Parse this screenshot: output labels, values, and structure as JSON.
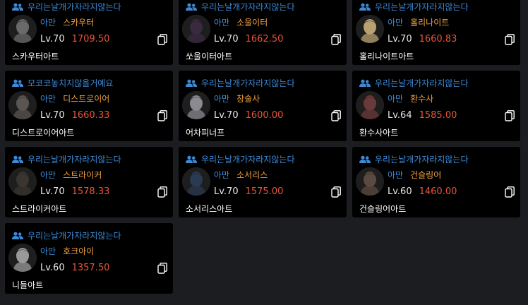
{
  "cards": [
    {
      "guild": "우리는날개가자라지않는다",
      "server": "아만",
      "class": "스카우터",
      "level": "Lv.70",
      "item_level": "1709.50",
      "name": "스카우터아트",
      "avatar_color": "#6a6a6a"
    },
    {
      "guild": "우리는날개가자라지않는다",
      "server": "아만",
      "class": "소울이터",
      "level": "Lv.70",
      "item_level": "1662.50",
      "name": "쏘울이터아트",
      "avatar_color": "#3a2a40"
    },
    {
      "guild": "우리는날개가자라지않는다",
      "server": "아만",
      "class": "홀리나이트",
      "level": "Lv.70",
      "item_level": "1660.83",
      "name": "홀리나이트아트",
      "avatar_color": "#b8a070"
    },
    {
      "guild": "모코코놓치지않을거예요",
      "server": "아만",
      "class": "디스트로이어",
      "level": "Lv.70",
      "item_level": "1660.33",
      "name": "디스트로이어아트",
      "avatar_color": "#5a5550"
    },
    {
      "guild": "우리는날개가자라지않는다",
      "server": "아만",
      "class": "창술사",
      "level": "Lv.70",
      "item_level": "1600.00",
      "name": "어차피너프",
      "avatar_color": "#8a8a90"
    },
    {
      "guild": "우리는날개가자라지않는다",
      "server": "아만",
      "class": "환수사",
      "level": "Lv.64",
      "item_level": "1585.00",
      "name": "환수사아트",
      "avatar_color": "#6a3a3a"
    },
    {
      "guild": "우리는날개가자라지않는다",
      "server": "아만",
      "class": "스트라이커",
      "level": "Lv.70",
      "item_level": "1578.33",
      "name": "스트라이커아트",
      "avatar_color": "#3a3530"
    },
    {
      "guild": "우리는날개가자라지않는다",
      "server": "아만",
      "class": "소서리스",
      "level": "Lv.70",
      "item_level": "1575.00",
      "name": "소서리스아트",
      "avatar_color": "#2a3a50"
    },
    {
      "guild": "우리는날개가자라지않는다",
      "server": "아만",
      "class": "건슬링어",
      "level": "Lv.60",
      "item_level": "1460.00",
      "name": "건슬링어아트",
      "avatar_color": "#5a4a40"
    },
    {
      "guild": "우리는날개가자라지않는다",
      "server": "아만",
      "class": "호크아이",
      "level": "Lv.60",
      "item_level": "1357.50",
      "name": "니들아트",
      "avatar_color": "#9a9a9a"
    }
  ],
  "colors": {
    "guild": "#3d8bd8",
    "class": "#f0a040",
    "item_level": "#e8553a",
    "card_bg": "#000000",
    "page_bg": "#1b1d21"
  },
  "icons": {
    "guild": "people-icon",
    "copy": "copy-icon",
    "avatar": "character-portrait"
  }
}
